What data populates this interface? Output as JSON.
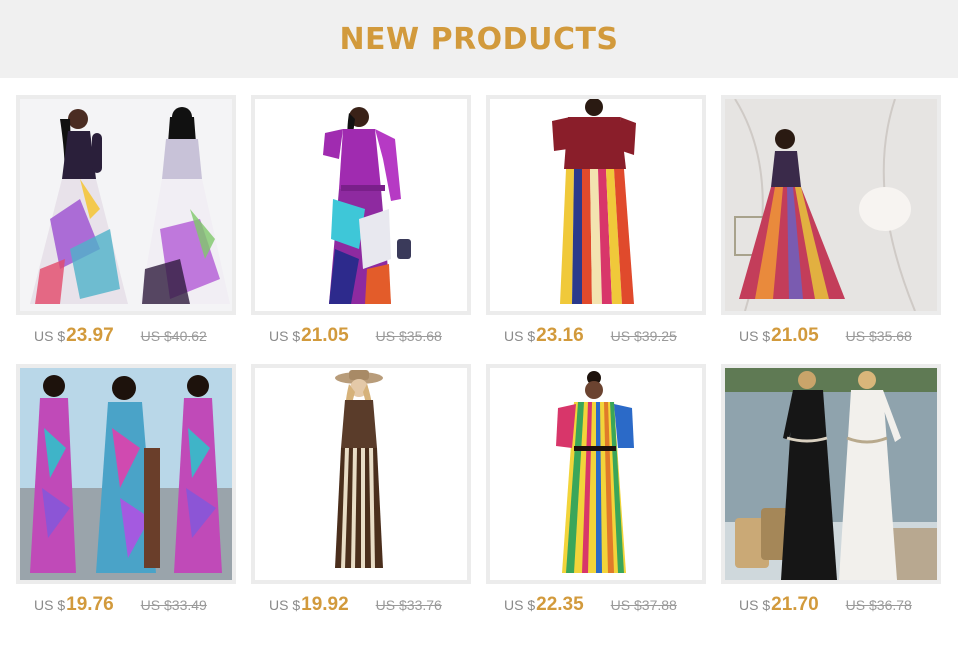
{
  "header": {
    "title": "NEW PRODUCTS"
  },
  "colors": {
    "accent": "#d29a3c",
    "banner_bg": "#f0f0f0",
    "frame": "#ececec",
    "muted_text": "#9a9a9a"
  },
  "products": [
    {
      "currency": "US $",
      "price": "23.97",
      "original_price": "US $40.62",
      "image": "floral-maxi-dress-front-back-photo"
    },
    {
      "currency": "US $",
      "price": "21.05",
      "original_price": "US $35.68",
      "image": "purple-geometric-print-maxi-dress-photo"
    },
    {
      "currency": "US $",
      "price": "23.16",
      "original_price": "US $39.25",
      "image": "burgundy-top-striped-maxi-dress-photo"
    },
    {
      "currency": "US $",
      "price": "21.05",
      "original_price": "US $35.68",
      "image": "rainbow-striped-maxi-dress-marble-room-photo"
    },
    {
      "currency": "US $",
      "price": "19.76",
      "original_price": "US $33.49",
      "image": "tropical-leaf-print-dress-three-view-photo"
    },
    {
      "currency": "US $",
      "price": "19.92",
      "original_price": "US $33.76",
      "image": "brown-striped-maxi-dress-hat-photo"
    },
    {
      "currency": "US $",
      "price": "22.35",
      "original_price": "US $37.88",
      "image": "multicolor-striped-shirt-dress-photo"
    },
    {
      "currency": "US $",
      "price": "21.70",
      "original_price": "US $36.78",
      "image": "black-and-white-maxi-dresses-lakeside-photo"
    }
  ]
}
